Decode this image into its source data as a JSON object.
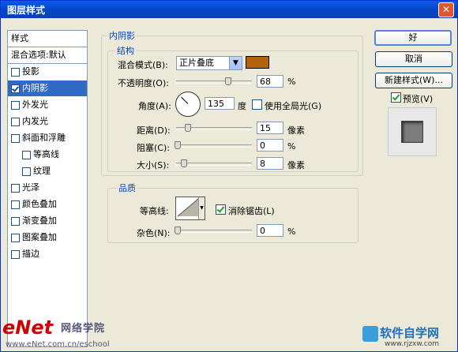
{
  "window": {
    "title": "图层样式",
    "close_glyph": "✕"
  },
  "styles_list": {
    "header": "样式",
    "blend_default": "混合选项:默认",
    "items": [
      {
        "label": "投影",
        "checked": false,
        "selected": false,
        "sub": false
      },
      {
        "label": "内阴影",
        "checked": true,
        "selected": true,
        "sub": false
      },
      {
        "label": "外发光",
        "checked": false,
        "selected": false,
        "sub": false
      },
      {
        "label": "内发光",
        "checked": false,
        "selected": false,
        "sub": false
      },
      {
        "label": "斜面和浮雕",
        "checked": false,
        "selected": false,
        "sub": false
      },
      {
        "label": "等高线",
        "checked": false,
        "selected": false,
        "sub": true
      },
      {
        "label": "纹理",
        "checked": false,
        "selected": false,
        "sub": true
      },
      {
        "label": "光泽",
        "checked": false,
        "selected": false,
        "sub": false
      },
      {
        "label": "颜色叠加",
        "checked": false,
        "selected": false,
        "sub": false
      },
      {
        "label": "渐变叠加",
        "checked": false,
        "selected": false,
        "sub": false
      },
      {
        "label": "图案叠加",
        "checked": false,
        "selected": false,
        "sub": false
      },
      {
        "label": "描边",
        "checked": false,
        "selected": false,
        "sub": false
      }
    ]
  },
  "inner_shadow": {
    "group_title": "内阴影",
    "structure_title": "结构",
    "blend_mode_label": "混合模式(B):",
    "blend_mode_value": "正片叠底",
    "shadow_color": "#b5620c",
    "opacity_label": "不透明度(O):",
    "opacity_value": "68",
    "opacity_unit": "%",
    "angle_label": "角度(A):",
    "angle_value": "135",
    "angle_unit": "度",
    "global_light_label": "使用全局光(G)",
    "global_light_checked": false,
    "distance_label": "距离(D):",
    "distance_value": "15",
    "distance_unit": "像素",
    "choke_label": "阻塞(C):",
    "choke_value": "0",
    "choke_unit": "%",
    "size_label": "大小(S):",
    "size_value": "8",
    "size_unit": "像素"
  },
  "quality": {
    "title": "品质",
    "contour_label": "等高线:",
    "anti_alias_label": "消除锯齿(L)",
    "anti_alias_checked": true,
    "noise_label": "杂色(N):",
    "noise_value": "0",
    "noise_unit": "%"
  },
  "buttons": {
    "ok": "好",
    "cancel": "取消",
    "new_style": "新建样式(W)...",
    "preview": "预览(V)",
    "preview_checked": true
  },
  "watermarks": {
    "left_logo": "eNet",
    "left_cn": "网络学院",
    "left_url": "www.eNet.com.cn/eschool",
    "right_cn": "软件自学网",
    "right_url": "www.rjzxw.com"
  }
}
